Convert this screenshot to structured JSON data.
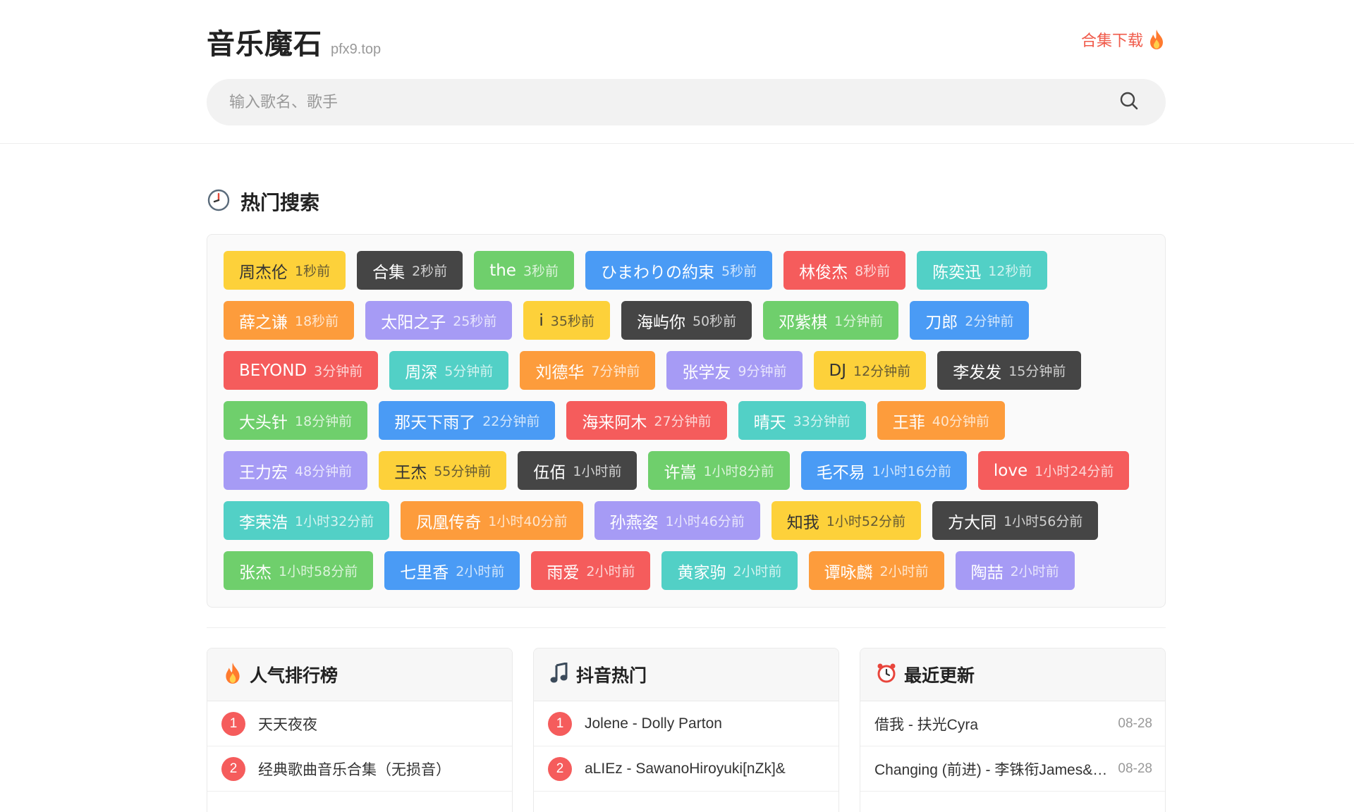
{
  "header": {
    "title": "音乐魔石",
    "domain": "pfx9.top",
    "download_label": "合集下载",
    "search_placeholder": "输入歌名、歌手"
  },
  "hot": {
    "title": "热门搜索",
    "tags": [
      {
        "name": "周杰伦",
        "time": "1秒前",
        "color": "yellow"
      },
      {
        "name": "合集",
        "time": "2秒前",
        "color": "dark"
      },
      {
        "name": "the",
        "time": "3秒前",
        "color": "green"
      },
      {
        "name": "ひまわりの約束",
        "time": "5秒前",
        "color": "blue"
      },
      {
        "name": "林俊杰",
        "time": "8秒前",
        "color": "red"
      },
      {
        "name": "陈奕迅",
        "time": "12秒前",
        "color": "teal"
      },
      {
        "name": "薛之谦",
        "time": "18秒前",
        "color": "orange"
      },
      {
        "name": "太阳之子",
        "time": "25秒前",
        "color": "purple"
      },
      {
        "name": "i",
        "time": "35秒前",
        "color": "yellow"
      },
      {
        "name": "海屿你",
        "time": "50秒前",
        "color": "dark"
      },
      {
        "name": "邓紫棋",
        "time": "1分钟前",
        "color": "green"
      },
      {
        "name": "刀郎",
        "time": "2分钟前",
        "color": "blue"
      },
      {
        "name": "BEYOND",
        "time": "3分钟前",
        "color": "red"
      },
      {
        "name": "周深",
        "time": "5分钟前",
        "color": "teal"
      },
      {
        "name": "刘德华",
        "time": "7分钟前",
        "color": "orange"
      },
      {
        "name": "张学友",
        "time": "9分钟前",
        "color": "purple"
      },
      {
        "name": "DJ",
        "time": "12分钟前",
        "color": "yellow"
      },
      {
        "name": "李发发",
        "time": "15分钟前",
        "color": "dark"
      },
      {
        "name": "大头针",
        "time": "18分钟前",
        "color": "green"
      },
      {
        "name": "那天下雨了",
        "time": "22分钟前",
        "color": "blue"
      },
      {
        "name": "海来阿木",
        "time": "27分钟前",
        "color": "red"
      },
      {
        "name": "晴天",
        "time": "33分钟前",
        "color": "teal"
      },
      {
        "name": "王菲",
        "time": "40分钟前",
        "color": "orange"
      },
      {
        "name": "王力宏",
        "time": "48分钟前",
        "color": "purple"
      },
      {
        "name": "王杰",
        "time": "55分钟前",
        "color": "yellow"
      },
      {
        "name": "伍佰",
        "time": "1小时前",
        "color": "dark"
      },
      {
        "name": "许嵩",
        "time": "1小时8分前",
        "color": "green"
      },
      {
        "name": "毛不易",
        "time": "1小时16分前",
        "color": "blue"
      },
      {
        "name": "love",
        "time": "1小时24分前",
        "color": "red"
      },
      {
        "name": "李荣浩",
        "time": "1小时32分前",
        "color": "teal"
      },
      {
        "name": "凤凰传奇",
        "time": "1小时40分前",
        "color": "orange"
      },
      {
        "name": "孙燕姿",
        "time": "1小时46分前",
        "color": "purple"
      },
      {
        "name": "知我",
        "time": "1小时52分前",
        "color": "yellow"
      },
      {
        "name": "方大同",
        "time": "1小时56分前",
        "color": "dark"
      },
      {
        "name": "张杰",
        "time": "1小时58分前",
        "color": "green"
      },
      {
        "name": "七里香",
        "time": "2小时前",
        "color": "blue"
      },
      {
        "name": "雨爱",
        "time": "2小时前",
        "color": "red"
      },
      {
        "name": "黄家驹",
        "time": "2小时前",
        "color": "teal"
      },
      {
        "name": "谭咏麟",
        "time": "2小时前",
        "color": "orange"
      },
      {
        "name": "陶喆",
        "time": "2小时前",
        "color": "purple"
      }
    ]
  },
  "popular": {
    "title": "人气排行榜",
    "items": [
      {
        "rank": "1",
        "song": "天天夜夜"
      },
      {
        "rank": "2",
        "song": "经典歌曲音乐合集（无损音）"
      }
    ]
  },
  "douyin": {
    "title": "抖音热门",
    "items": [
      {
        "rank": "1",
        "song": "Jolene - Dolly Parton"
      },
      {
        "rank": "2",
        "song": "aLIEz - SawanoHiroyuki[nZk]&"
      }
    ]
  },
  "recent": {
    "title": "最近更新",
    "items": [
      {
        "song": "借我 - 扶光Cyra",
        "date": "08-28"
      },
      {
        "song": "Changing (前进) - 李铢衔James&Ailee",
        "date": "08-28"
      }
    ]
  },
  "colors": {
    "yellow": "#fdd13a",
    "dark": "#454545",
    "green": "#6fcf6c",
    "blue": "#4a9bf5",
    "red": "#f55c5c",
    "teal": "#52d0c6",
    "orange": "#fd9c3c",
    "purple": "#a69bf5",
    "accent": "#f05a4a"
  }
}
